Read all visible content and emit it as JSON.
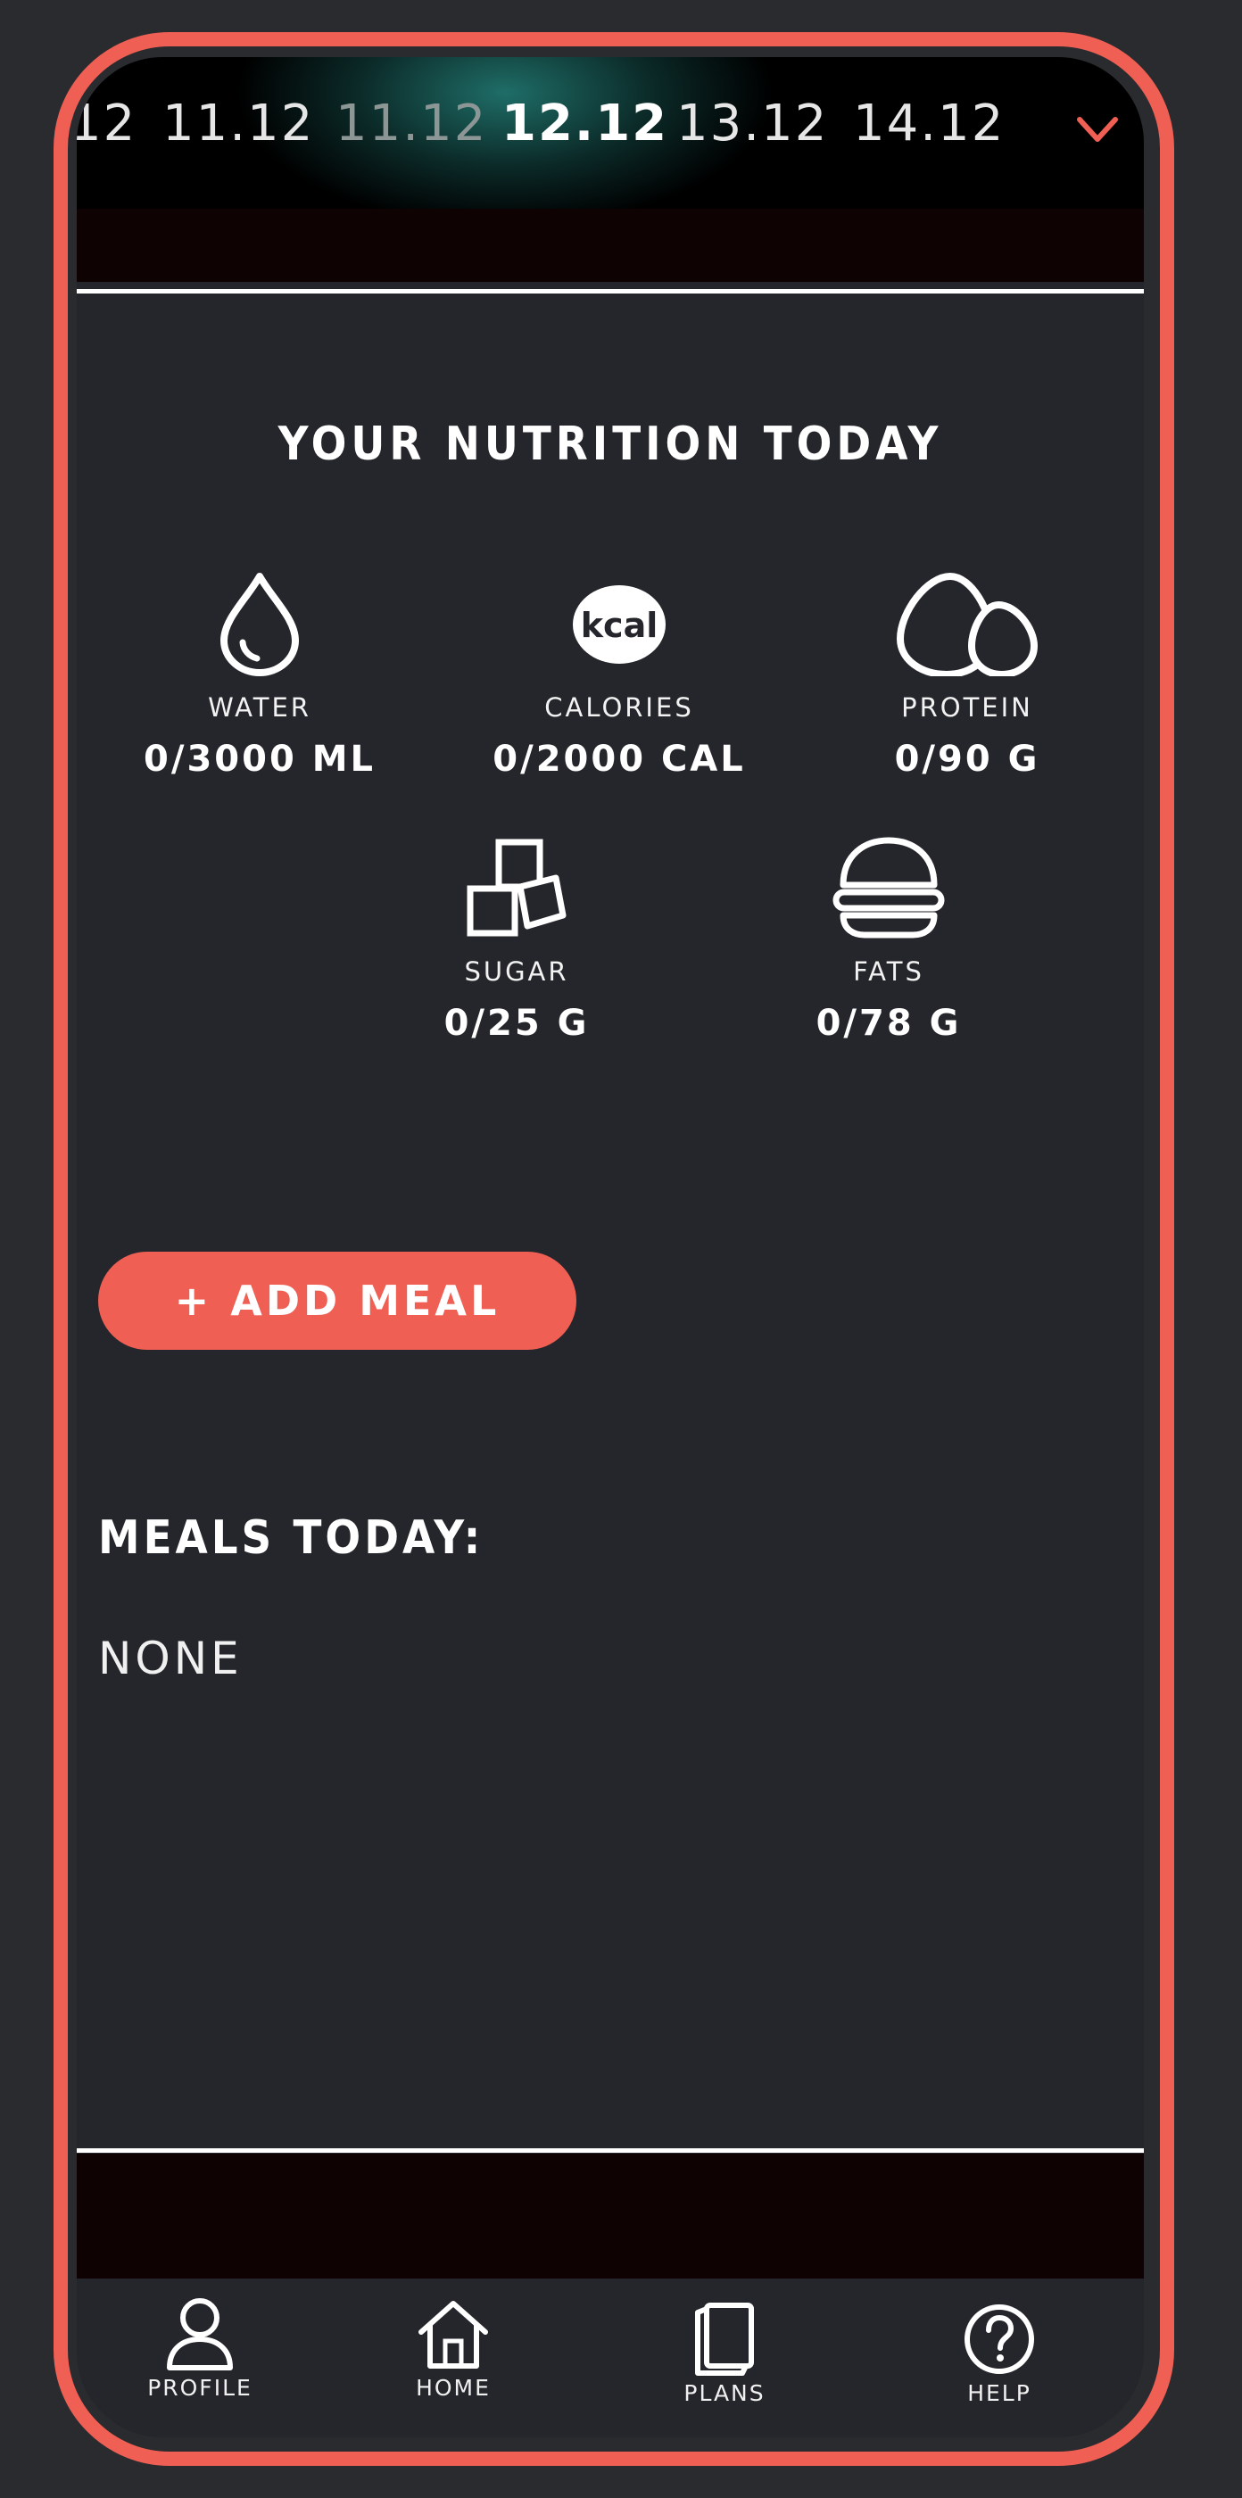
{
  "dates": {
    "items": [
      {
        "label": "12",
        "style": "normal"
      },
      {
        "label": "11.12",
        "style": "normal"
      },
      {
        "label": "11.12",
        "style": "faded"
      },
      {
        "label": "12.12",
        "style": "active"
      },
      {
        "label": "13.12",
        "style": "normal"
      },
      {
        "label": "14.12",
        "style": "normal"
      }
    ],
    "toggle_icon": "chevron-down-icon"
  },
  "nutrition": {
    "title": "YOUR NUTRITION TODAY",
    "stats": [
      {
        "icon": "water-drop-icon",
        "label": "WATER",
        "value": "0/3000 ML"
      },
      {
        "icon": "kcal-icon",
        "icon_text": "kcal",
        "label": "CALORIES",
        "value": "0/2000 CAL"
      },
      {
        "icon": "eggs-icon",
        "label": "PROTEIN",
        "value": "0/90 G"
      },
      {
        "icon": "sugar-cubes-icon",
        "label": "SUGAR",
        "value": "0/25 G"
      },
      {
        "icon": "burger-icon",
        "label": "FATS",
        "value": "0/78 G"
      }
    ]
  },
  "add_meal": {
    "label": "+ ADD MEAL"
  },
  "meals": {
    "heading": "MEALS TODAY:",
    "empty_text": "NONE"
  },
  "nav": [
    {
      "icon": "user-icon",
      "label": "PROFILE"
    },
    {
      "icon": "home-icon",
      "label": "HOME"
    },
    {
      "icon": "notebook-icon",
      "label": "PLANS"
    },
    {
      "icon": "help-icon",
      "label": "HELP"
    }
  ],
  "colors": {
    "accent": "#ef5f53",
    "background": "#25262b",
    "band": "#0f0203",
    "teal": "#1f6d67"
  }
}
